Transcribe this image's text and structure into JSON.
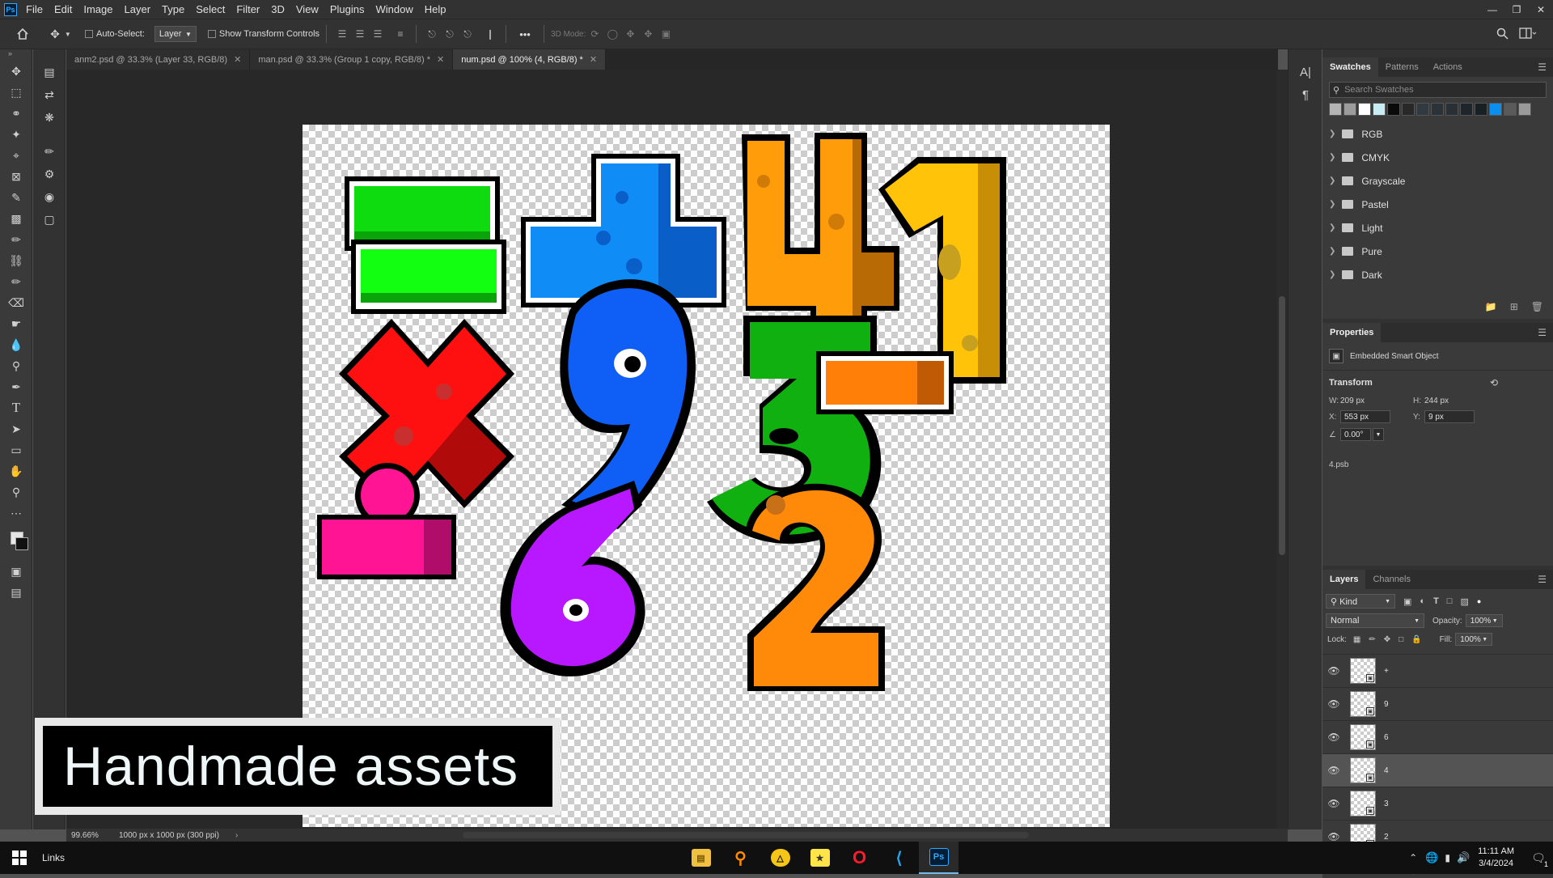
{
  "menubar": {
    "logo": "Ps",
    "items": [
      "File",
      "Edit",
      "Image",
      "Layer",
      "Type",
      "Select",
      "Filter",
      "3D",
      "View",
      "Plugins",
      "Window",
      "Help"
    ]
  },
  "options": {
    "auto_select_label": "Auto-Select:",
    "auto_select_value": "Layer",
    "show_transform_label": "Show Transform Controls",
    "mode_3d_label": "3D Mode:",
    "more": "•••"
  },
  "tabs": [
    {
      "label": "anm2.psd @ 33.3% (Layer 33, RGB/8)"
    },
    {
      "label": "man.psd @ 33.3% (Group 1 copy, RGB/8) *"
    },
    {
      "label": "num.psd @ 100% (4, RGB/8) *"
    }
  ],
  "canvas": {
    "caption": "Handmade assets"
  },
  "status": {
    "zoom": "99.66%",
    "doc_info": "1000 px x 1000 px (300 ppi)"
  },
  "swatches_panel": {
    "tabs": [
      "Swatches",
      "Patterns",
      "Actions"
    ],
    "search_placeholder": "Search Swatches",
    "colors": [
      "#b4b4b4",
      "#9c9c9c",
      "#ffffff",
      "#c8ecf4",
      "#0a0a0a",
      "#282828",
      "#303a40",
      "#2c3338",
      "#283036",
      "#1e262c",
      "#182024",
      "#0a8ef0",
      "#5a5a5a",
      "#9a9a9a"
    ],
    "folders": [
      "RGB",
      "CMYK",
      "Grayscale",
      "Pastel",
      "Light",
      "Pure",
      "Dark"
    ]
  },
  "properties_panel": {
    "title": "Properties",
    "object_type": "Embedded Smart Object",
    "transform_label": "Transform",
    "w_label": "W:",
    "w_value": "209 px",
    "h_label": "H:",
    "h_value": "244 px",
    "x_label": "X:",
    "x_value": "553 px",
    "y_label": "Y:",
    "y_value": "9 px",
    "angle_value": "0.00°",
    "file_name": "4.psb"
  },
  "layers_panel": {
    "tabs": [
      "Layers",
      "Channels"
    ],
    "filter_label": "Kind",
    "blend_mode": "Normal",
    "opacity_label": "Opacity:",
    "opacity_value": "100%",
    "lock_label": "Lock:",
    "fill_label": "Fill:",
    "fill_value": "100%",
    "layers": [
      {
        "name": "+"
      },
      {
        "name": "9"
      },
      {
        "name": "6"
      },
      {
        "name": "4",
        "selected": true
      },
      {
        "name": "3"
      },
      {
        "name": "2"
      }
    ]
  },
  "taskbar": {
    "links_label": "Links",
    "time": "11:11 AM",
    "date": "3/4/2024",
    "notification_count": "1"
  }
}
